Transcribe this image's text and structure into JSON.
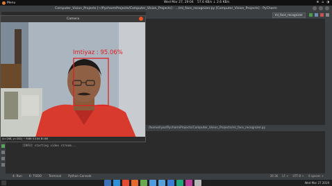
{
  "system_bar": {
    "menu_label": "Menu",
    "clock": "Wed Mar 27, 29:04",
    "stats": "57.6 KB/s ↓ 2.6 KB/s",
    "right_items": [
      "⊕",
      "⌂",
      "◑"
    ]
  },
  "ide": {
    "title": "Computer_Vision_Projects [~/PycharmProjects/Computer_Vision_Projects] - .../ml_face_recognizer.py [Computer_Vision_Projects] - PyCharm",
    "run_config": "ml_face_recognizer",
    "run_path": "/home/liyaz/PycharmProjects/Computer_Vision_Projects/ml_face_recognizer.py",
    "console_text": "[INFO] starting video stream..."
  },
  "camera": {
    "title": "Camera",
    "detection_label": "Imtiyaz",
    "confidence": "95.06%",
    "status_text": "(x=208, y=152) ~ R:88 G:104 B:160"
  },
  "tool_tabs": [
    "4: Run",
    "6: TODO",
    "Terminal",
    "Python Console"
  ],
  "status_items": [
    "36:36",
    "LF ÷",
    "UTF-8 ÷",
    "4 spaces ÷"
  ],
  "dock": {
    "right_text": "Wed Mar 27 2019",
    "app_colors": [
      "#3b6fb6",
      "#2f8fd8",
      "#e24a33",
      "#e8672c",
      "#6aa84f",
      "#4f9be0",
      "#5aa0d8",
      "#3a7bd5",
      "#21a67a",
      "#bd3c9a",
      "#b5b5b5",
      "#1f1f1f"
    ]
  },
  "colors": {
    "bbox": "#e02020",
    "shirt": "#d83a2e",
    "accent": "#e95420"
  }
}
